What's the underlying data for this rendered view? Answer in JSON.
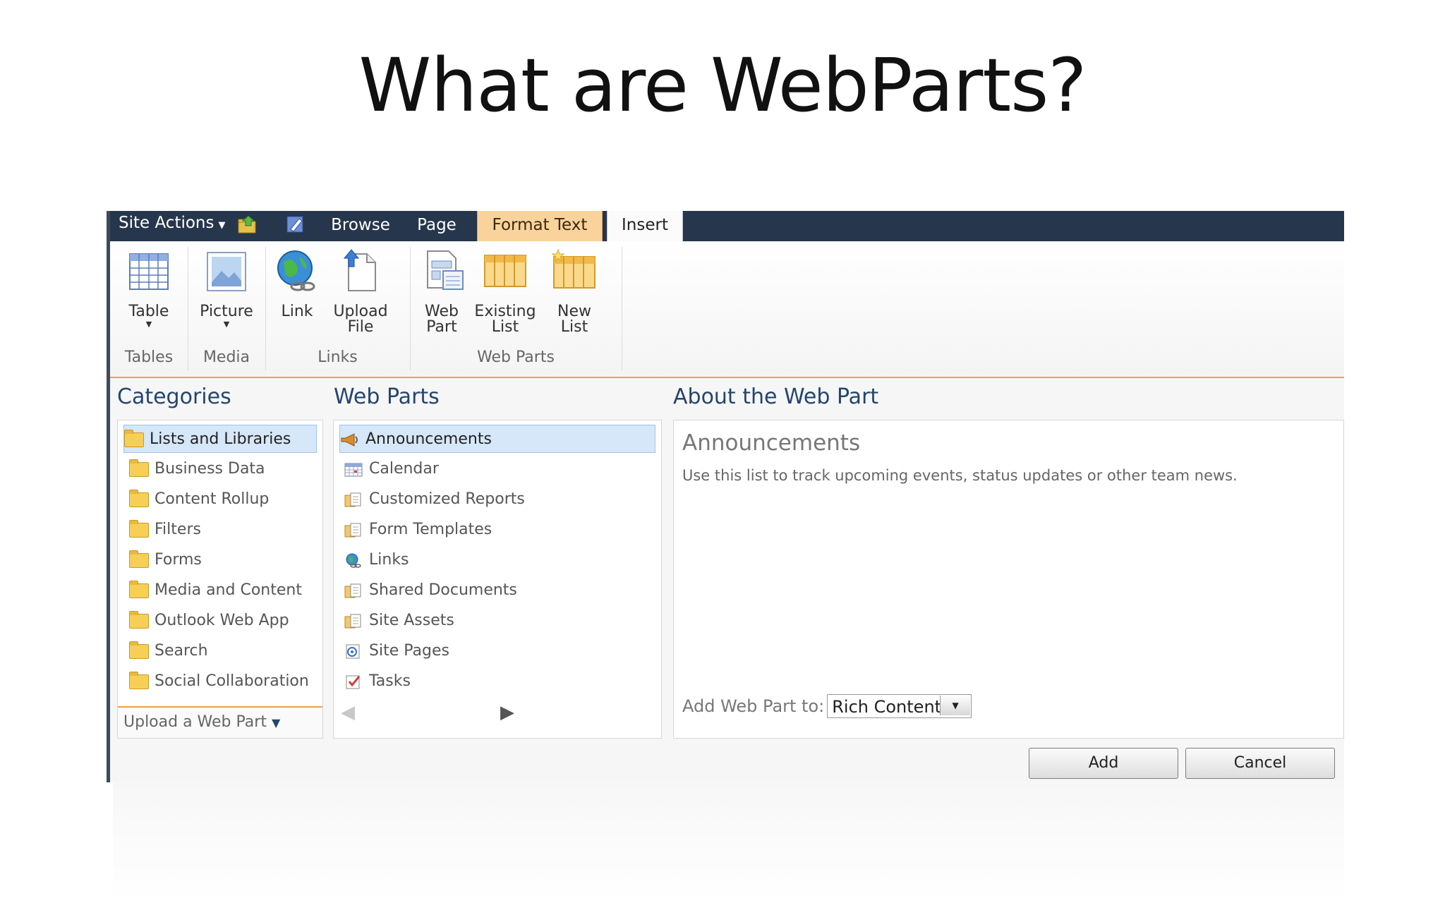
{
  "slide": {
    "title": "What are WebParts?"
  },
  "topbar": {
    "site_actions": "Site Actions",
    "tabs": [
      {
        "label": "Browse"
      },
      {
        "label": "Page"
      },
      {
        "label": "Format Text"
      },
      {
        "label": "Insert"
      }
    ]
  },
  "ribbon": {
    "buttons": {
      "table": "Table",
      "picture": "Picture",
      "link": "Link",
      "upload_file_1": "Upload",
      "upload_file_2": "File",
      "web_part_1": "Web",
      "web_part_2": "Part",
      "existing_list_1": "Existing",
      "existing_list_2": "List",
      "new_list_1": "New",
      "new_list_2": "List"
    },
    "groups": {
      "tables": "Tables",
      "media": "Media",
      "links": "Links",
      "web_parts": "Web Parts"
    }
  },
  "categories": {
    "heading": "Categories",
    "items": [
      "Lists and Libraries",
      "Business Data",
      "Content Rollup",
      "Filters",
      "Forms",
      "Media and Content",
      "Outlook Web App",
      "Search",
      "Social Collaboration"
    ],
    "upload": "Upload a Web Part"
  },
  "webparts": {
    "heading": "Web Parts",
    "items": [
      "Announcements",
      "Calendar",
      "Customized Reports",
      "Form Templates",
      "Links",
      "Shared Documents",
      "Site Assets",
      "Site Pages",
      "Tasks"
    ]
  },
  "about": {
    "heading": "About the Web Part",
    "title": "Announcements",
    "description": "Use this list to track upcoming events, status updates or other team news.",
    "add_to_label": "Add Web Part to:",
    "add_to_value": "Rich Content"
  },
  "actions": {
    "add": "Add",
    "cancel": "Cancel"
  },
  "colors": {
    "topbar": "#26364c",
    "accent": "#f0a040",
    "selected": "#d5e7f8",
    "heading": "#24456e"
  }
}
